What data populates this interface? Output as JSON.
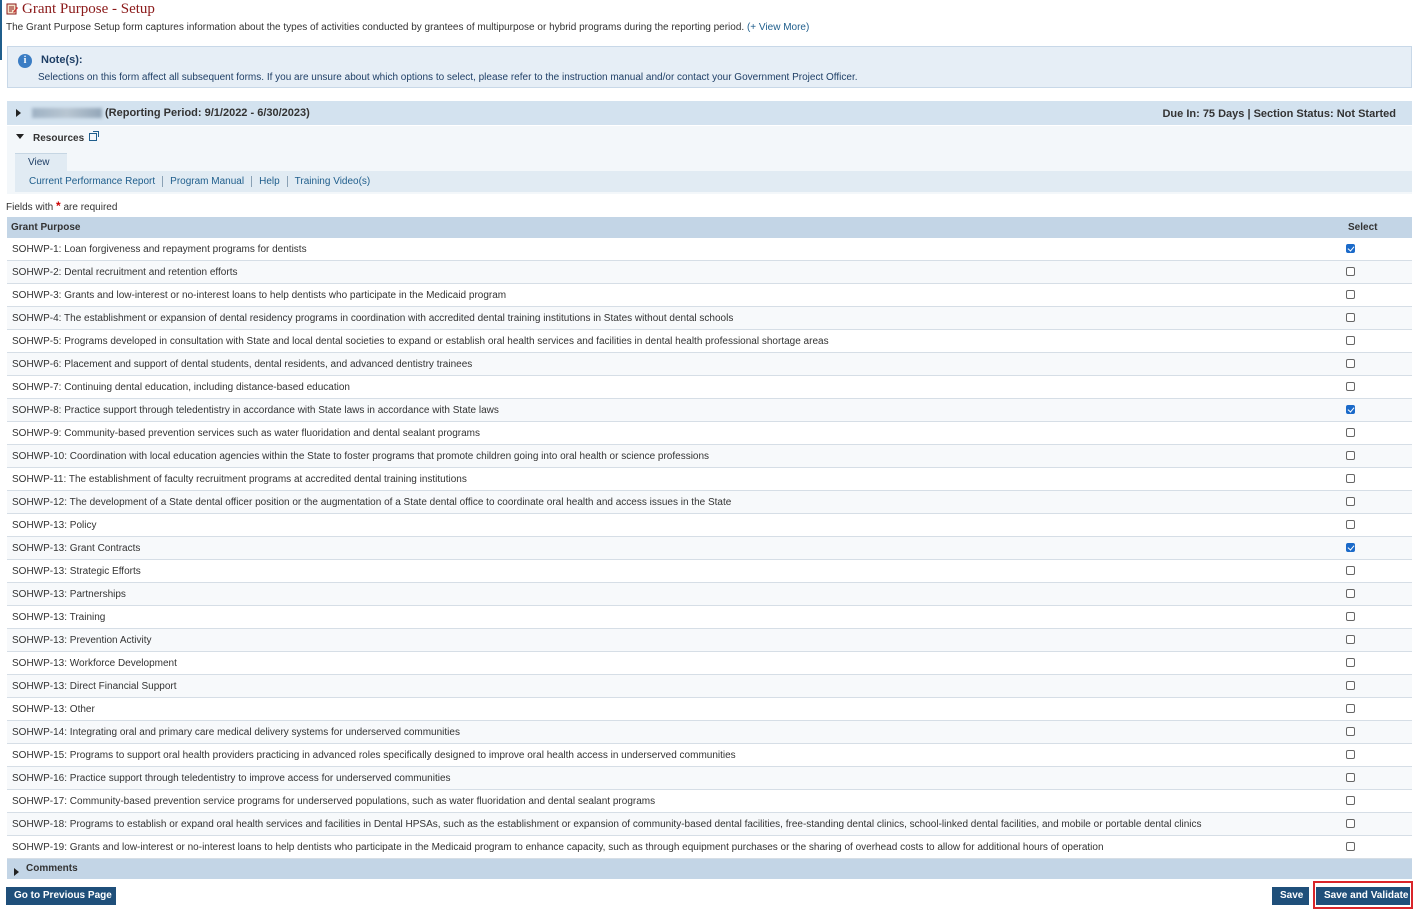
{
  "page": {
    "title": "Grant Purpose - Setup",
    "description": "The Grant Purpose Setup form captures information about the types of activities conducted by grantees of multipurpose or hybrid programs during the reporting period.",
    "view_more": "(+ View More)"
  },
  "note": {
    "icon": "info-icon",
    "title": "Note(s):",
    "text": "Selections on this form affect all subsequent forms. If you are unsure about which options to select, please refer to the instruction manual and/or contact your Government Project Officer."
  },
  "period": {
    "text": "(Reporting Period: 9/1/2022 - 6/30/2023)",
    "status": "Due In: 75 Days | Section Status: Not Started"
  },
  "resources": {
    "title": "Resources",
    "tab": "View",
    "links": [
      "Current Performance Report",
      "Program Manual",
      "Help",
      "Training Video(s)"
    ]
  },
  "form": {
    "required_prefix": "Fields with",
    "required_star": "*",
    "required_suffix": "are required"
  },
  "table": {
    "headers": [
      "Grant Purpose",
      "Select"
    ],
    "rows": [
      {
        "label": "SOHWP-1: Loan forgiveness and repayment programs for dentists",
        "checked": true
      },
      {
        "label": "SOHWP-2: Dental recruitment and retention efforts",
        "checked": false
      },
      {
        "label": "SOHWP-3: Grants and low-interest or no-interest loans to help dentists who participate in the Medicaid program",
        "checked": false
      },
      {
        "label": "SOHWP-4: The establishment or expansion of dental residency programs in coordination with accredited dental training institutions in States without dental schools",
        "checked": false
      },
      {
        "label": "SOHWP-5: Programs developed in consultation with State and local dental societies to expand or establish oral health services and facilities in dental health professional shortage areas",
        "checked": false
      },
      {
        "label": "SOHWP-6: Placement and support of dental students, dental residents, and advanced dentistry trainees",
        "checked": false
      },
      {
        "label": "SOHWP-7: Continuing dental education, including distance-based education",
        "checked": false
      },
      {
        "label": "SOHWP-8: Practice support through teledentistry in accordance with State laws in accordance with State laws",
        "checked": true
      },
      {
        "label": "SOHWP-9: Community-based prevention services such as water fluoridation and dental sealant programs",
        "checked": false
      },
      {
        "label": "SOHWP-10: Coordination with local education agencies within the State to foster programs that promote children going into oral health or science professions",
        "checked": false
      },
      {
        "label": "SOHWP-11: The establishment of faculty recruitment programs at accredited dental training institutions",
        "checked": false
      },
      {
        "label": "SOHWP-12: The development of a State dental officer position or the augmentation of a State dental office to coordinate oral health and access issues in the State",
        "checked": false
      },
      {
        "label": "SOHWP-13: Policy",
        "checked": false
      },
      {
        "label": "SOHWP-13: Grant Contracts",
        "checked": true
      },
      {
        "label": "SOHWP-13: Strategic Efforts",
        "checked": false
      },
      {
        "label": "SOHWP-13: Partnerships",
        "checked": false
      },
      {
        "label": "SOHWP-13: Training",
        "checked": false
      },
      {
        "label": "SOHWP-13: Prevention Activity",
        "checked": false
      },
      {
        "label": "SOHWP-13: Workforce Development",
        "checked": false
      },
      {
        "label": "SOHWP-13: Direct Financial Support",
        "checked": false
      },
      {
        "label": "SOHWP-13: Other",
        "checked": false
      },
      {
        "label": "SOHWP-14: Integrating oral and primary care medical delivery systems for underserved communities",
        "checked": false
      },
      {
        "label": "SOHWP-15: Programs to support oral health providers practicing in advanced roles specifically designed to improve oral health access in underserved communities",
        "checked": false
      },
      {
        "label": "SOHWP-16: Practice support through teledentistry to improve access for underserved communities",
        "checked": false
      },
      {
        "label": "SOHWP-17: Community-based prevention service programs for underserved populations, such as water fluoridation and dental sealant programs",
        "checked": false
      },
      {
        "label": "SOHWP-18: Programs to establish or expand oral health services and facilities in Dental HPSAs, such as the establishment or expansion of community-based dental facilities, free-standing dental clinics, school-linked dental facilities, and mobile or portable dental clinics",
        "checked": false
      },
      {
        "label": "SOHWP-19: Grants and low-interest or no-interest loans to help dentists who participate in the Medicaid program to enhance capacity, such as through equipment purchases or the sharing of overhead costs to allow for additional hours of operation",
        "checked": false
      }
    ]
  },
  "comments": {
    "title": "Comments"
  },
  "buttons": {
    "previous": "Go to Previous Page",
    "save": "Save",
    "save_validate": "Save and Validate"
  },
  "colors": {
    "accent": "#1f4f7a",
    "title": "#8b1a1a",
    "highlight": "#d9252a",
    "checkbox": "#1b6ac9"
  }
}
